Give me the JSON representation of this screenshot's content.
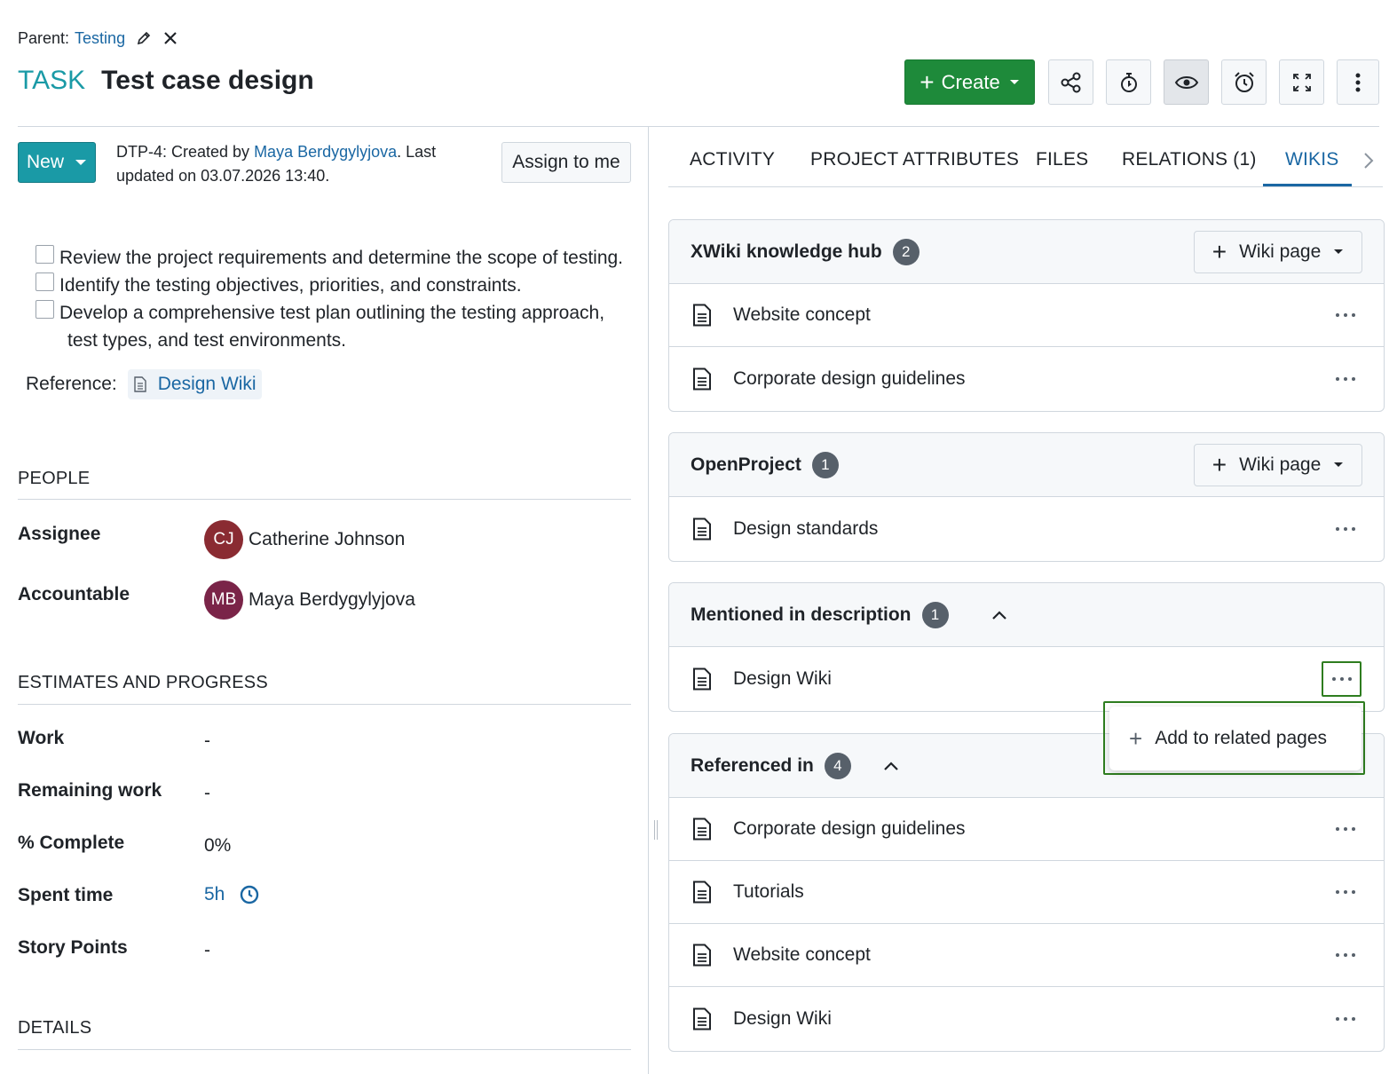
{
  "header": {
    "parent_label": "Parent:",
    "parent_link": "Testing",
    "type": "TASK",
    "subject": "Test case design"
  },
  "toolbar": {
    "create_label": "Create",
    "icons": [
      "share-icon",
      "timer-icon",
      "eye-icon",
      "alarm-icon",
      "fullscreen-icon",
      "more-vertical-icon"
    ]
  },
  "status": {
    "label": "New"
  },
  "meta": {
    "prefix": "DTP-4: Created by ",
    "author": "Maya Berdygylyjova",
    "suffix": ". Last updated on 03.07.2026 13:40."
  },
  "assign_button": "Assign to me",
  "checklist": [
    "Review the project requirements and determine the scope of testing.",
    "Identify the testing objectives, priorities, and constraints.",
    "Develop a comprehensive test plan outlining the testing approach,",
    "test types, and test environments."
  ],
  "reference": {
    "label": "Reference:",
    "link": "Design Wiki"
  },
  "people": {
    "title": "PEOPLE",
    "assignee_label": "Assignee",
    "assignee_initials": "CJ",
    "assignee_name": "Catherine Johnson",
    "accountable_label": "Accountable",
    "accountable_initials": "MB",
    "accountable_name": "Maya Berdygylyjova"
  },
  "estimates": {
    "title": "ESTIMATES AND PROGRESS",
    "work_label": "Work",
    "work_value": "-",
    "remaining_label": "Remaining work",
    "remaining_value": "-",
    "complete_label": "% Complete",
    "complete_value": "0%",
    "spent_label": "Spent time",
    "spent_value": "5h",
    "story_label": "Story Points",
    "story_value": "-"
  },
  "details": {
    "title": "DETAILS"
  },
  "tabs": [
    "ACTIVITY",
    "PROJECT ATTRIBUTES",
    "FILES",
    "RELATIONS (1)",
    "WIKIS"
  ],
  "active_tab": "WIKIS",
  "wiki_button_label": "Wiki page",
  "sections": {
    "xwiki": {
      "title": "XWiki knowledge hub",
      "count": "2",
      "items": [
        "Website concept",
        "Corporate design guidelines"
      ]
    },
    "openproject": {
      "title": "OpenProject",
      "count": "1",
      "items": [
        "Design standards"
      ]
    },
    "mentioned": {
      "title": "Mentioned in description",
      "count": "1",
      "items": [
        "Design Wiki"
      ]
    },
    "referenced": {
      "title": "Referenced in",
      "count": "4",
      "items": [
        "Corporate design guidelines",
        "Tutorials",
        "Website concept",
        "Design Wiki"
      ]
    }
  },
  "popup": {
    "label": "Add to related pages"
  },
  "colors": {
    "accent": "#1a9aa6",
    "link": "#1a67a3",
    "create": "#1e8a3a",
    "highlight": "#2e7d1f"
  }
}
